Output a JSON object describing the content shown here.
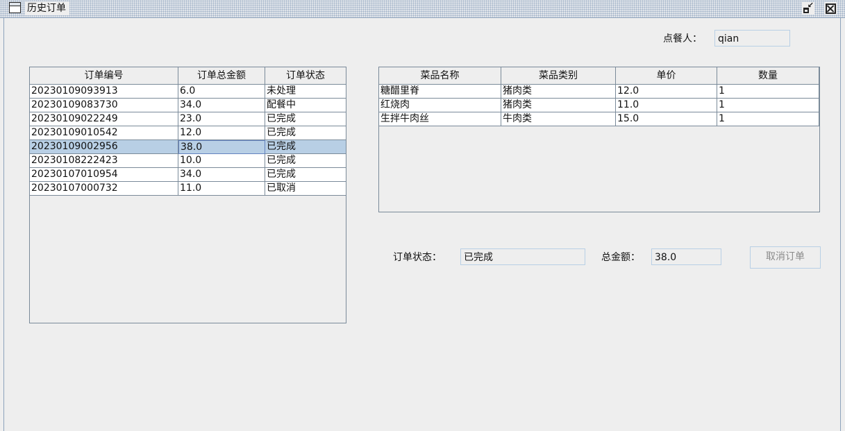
{
  "window": {
    "title": "历史订单",
    "icon": "window-icon",
    "controls": [
      "restore-icon",
      "close-icon"
    ]
  },
  "customer": {
    "label": "点餐人：",
    "value": "qian"
  },
  "orders": {
    "columns": [
      "订单编号",
      "订单总金额",
      "订单状态"
    ],
    "rows": [
      [
        "20230109093913",
        "6.0",
        "未处理"
      ],
      [
        "20230109083730",
        "34.0",
        "配餐中"
      ],
      [
        "20230109022249",
        "23.0",
        "已完成"
      ],
      [
        "20230109010542",
        "12.0",
        "已完成"
      ],
      [
        "20230109002956",
        "38.0",
        "已完成"
      ],
      [
        "20230108222423",
        "10.0",
        "已完成"
      ],
      [
        "20230107010954",
        "34.0",
        "已完成"
      ],
      [
        "20230107000732",
        "11.0",
        "已取消"
      ]
    ],
    "selected_index": 4
  },
  "dishes": {
    "columns": [
      "菜品名称",
      "菜品类别",
      "单价",
      "数量"
    ],
    "rows": [
      [
        "糖醋里脊",
        "猪肉类",
        "12.0",
        "1"
      ],
      [
        "红烧肉",
        "猪肉类",
        "11.0",
        "1"
      ],
      [
        "生拌牛肉丝",
        "牛肉类",
        "15.0",
        "1"
      ]
    ]
  },
  "summary": {
    "status_label": "订单状态：",
    "status_value": "已完成",
    "total_label": "总金额：",
    "total_value": "38.0",
    "cancel_button": "取消订单"
  },
  "colors": {
    "selection": "#b8cfe5",
    "border": "#7a8a99",
    "background": "#eeeeee"
  }
}
